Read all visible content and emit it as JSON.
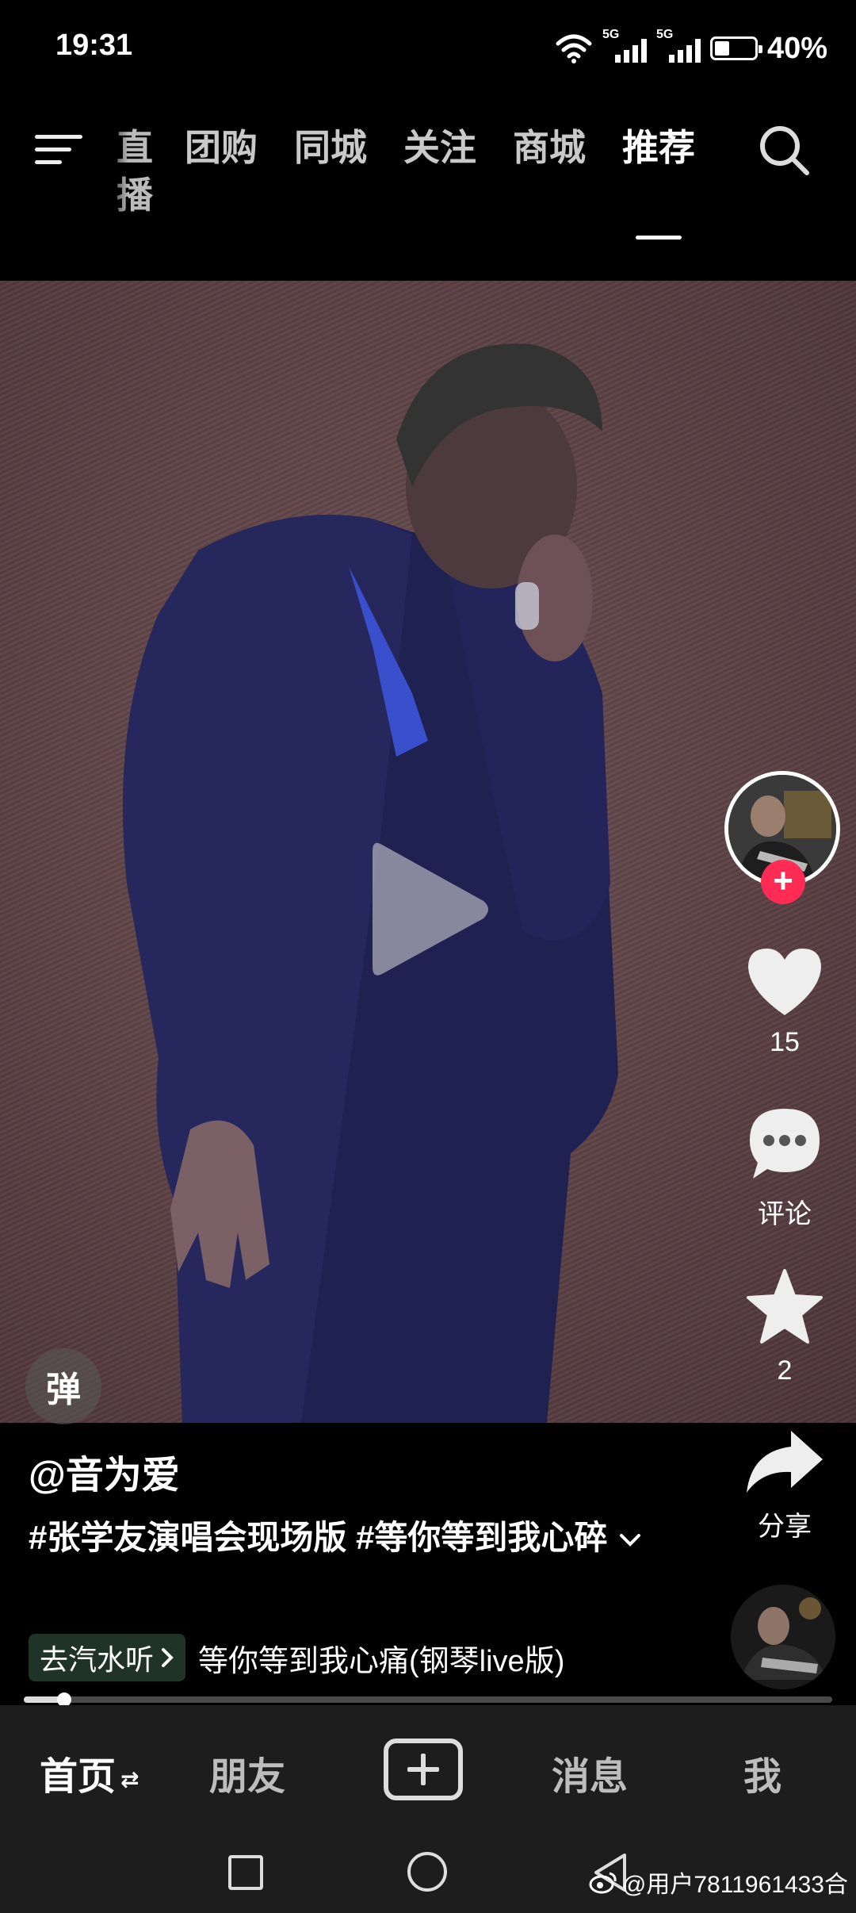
{
  "status_bar": {
    "time": "19:31",
    "network_1": "5G",
    "network_2": "5G",
    "battery": "40%",
    "icons": [
      "wifi-icon",
      "signal-icon",
      "signal-icon",
      "battery-icon"
    ]
  },
  "top_nav": {
    "tabs": [
      {
        "label": "直播",
        "state": "partially-scrolled"
      },
      {
        "label": "团购"
      },
      {
        "label": "同城"
      },
      {
        "label": "关注"
      },
      {
        "label": "商城"
      },
      {
        "label": "推荐",
        "active": true
      }
    ],
    "menu_icon": "menu-icon",
    "search_icon": "search-icon"
  },
  "video": {
    "state": "paused",
    "danmu_label": "弹"
  },
  "actions": {
    "like_count": "15",
    "comment_label": "评论",
    "favorite_count": "2",
    "share_label": "分享",
    "follow_symbol": "+"
  },
  "post": {
    "author": "@音为爱",
    "caption": "#张学友演唱会现场版 #等你等到我心碎",
    "music_chip": "去汽水听",
    "music_title": "等你等到我心痛(钢琴live版)",
    "progress": 0.05
  },
  "tabbar": {
    "home": "首页",
    "home_swap": "⇄",
    "friends": "朋友",
    "messages": "消息",
    "me": "我"
  },
  "watermark": "@用户7811961433合",
  "colors": {
    "accent_red": "#fe2c55",
    "background": "#000000",
    "tabbar": "#1d1d1d"
  }
}
